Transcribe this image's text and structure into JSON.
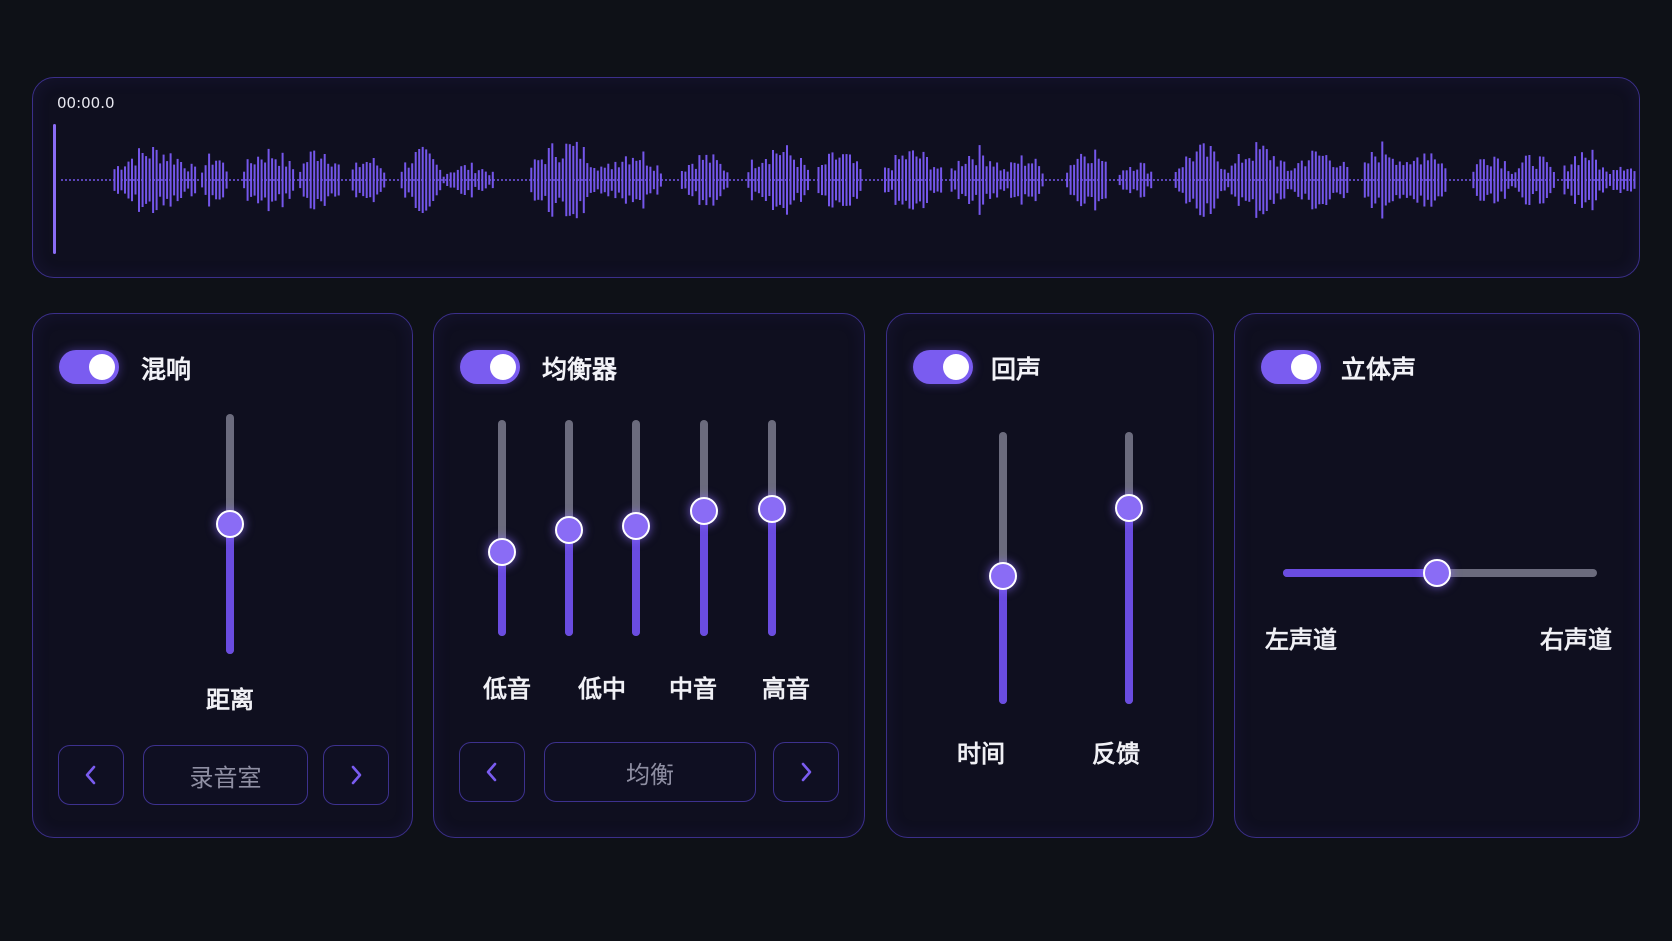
{
  "waveform": {
    "time": "00:00.0",
    "color": "#7456ea",
    "playhead_color": "#8a6cf5"
  },
  "reverb": {
    "title": "混响",
    "enabled": true,
    "distance_label": "距离",
    "distance_value": 0.54,
    "preset": "录音室"
  },
  "equalizer": {
    "title": "均衡器",
    "enabled": true,
    "bands": [
      {
        "label": "低音",
        "value": 0.39
      },
      {
        "label": "低中",
        "value": 0.49
      },
      {
        "label": "中音",
        "value": 0.51
      },
      {
        "label": "高音",
        "value": 0.58
      },
      {
        "label": "高音",
        "value": 0.59
      }
    ],
    "band_labels_shown": [
      "低音",
      "低中",
      "中音",
      "高音"
    ],
    "preset": "均衡"
  },
  "echo": {
    "title": "回声",
    "enabled": true,
    "sliders": [
      {
        "label": "时间",
        "value": 0.47
      },
      {
        "label": "反馈",
        "value": 0.72
      }
    ]
  },
  "stereo": {
    "title": "立体声",
    "enabled": true,
    "balance": 0.49,
    "left_label": "左声道",
    "right_label": "右声道"
  },
  "colors": {
    "accent": "#7a5cf0",
    "border": "#3b2f8a",
    "background": "#0e1117"
  },
  "icons": {
    "prev": "chevron-left-icon",
    "next": "chevron-right-icon"
  }
}
